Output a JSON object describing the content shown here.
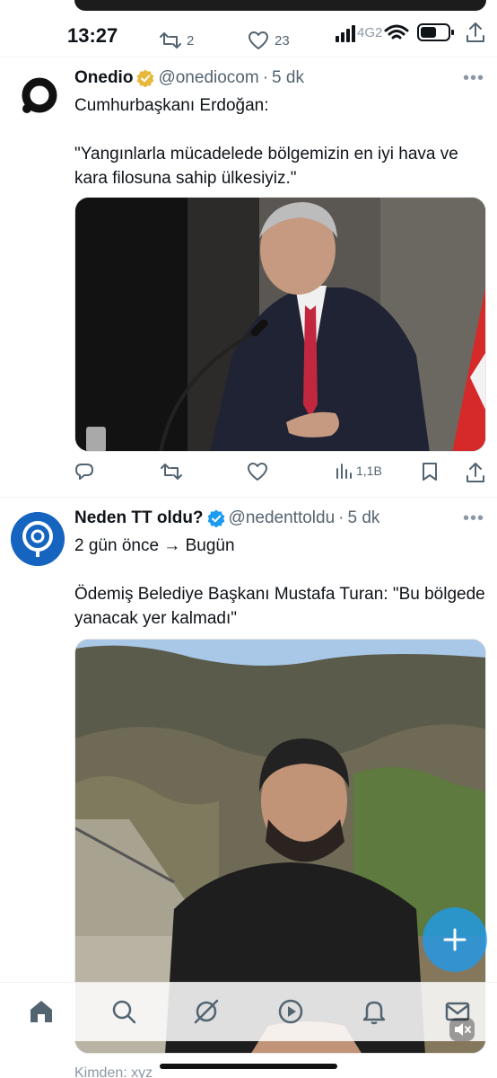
{
  "status_bar": {
    "time": "13:27",
    "signal": "4G2"
  },
  "previous_tweet_actions": {
    "retweets": "2",
    "likes": "23"
  },
  "tweets": [
    {
      "display_name": "Onedio",
      "handle": "@onediocom",
      "separator": "·",
      "time": "5 dk",
      "verified_color": "#e8b83a",
      "text": "Cumhurbaşkanı Erdoğan:\n\n\"Yangınlarla mücadelede bölgemizin en iyi hava ve kara filosuna sahip ülkesiyiz.\"",
      "views": "1,1B"
    },
    {
      "display_name": "Neden TT oldu?",
      "handle": "@nedenttoldu",
      "separator": "·",
      "time": "5 dk",
      "verified_color": "#1d9bf0",
      "text": "2 gün önce → Bugün\n\nÖdemiş Belediye Başkanı Mustafa Turan: \"Bu bölgede yanacak yer kalmadı\""
    }
  ],
  "footer": {
    "from_text": "Kimden: xyz"
  },
  "bottom_nav": {
    "items": [
      "home-icon",
      "search-icon",
      "grok-icon",
      "video-icon",
      "notifications-icon",
      "messages-icon"
    ]
  },
  "colors": {
    "accent": "#1d9bf0",
    "muted_text": "#536471"
  }
}
